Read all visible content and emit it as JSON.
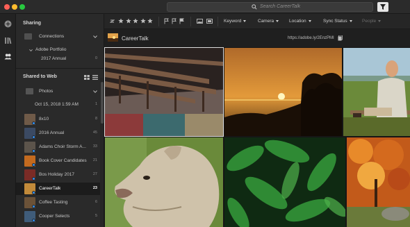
{
  "search": {
    "placeholder": "Search CareerTalk"
  },
  "sidebar": {
    "sharing": {
      "title": "Sharing",
      "connections_label": "Connections",
      "portfolio_label": "Adobe Portfolio",
      "portfolio_sub_label": "2017 Annual",
      "portfolio_sub_count": "0"
    },
    "shared_to_web": {
      "title": "Shared to Web",
      "photos_label": "Photos",
      "date_label": "Oct 15, 2018 1:59 AM",
      "date_count": "1"
    },
    "albums": [
      {
        "name": "8x10",
        "count": "8",
        "thumb": "#6f5a48",
        "selected": false
      },
      {
        "name": "2016 Annual",
        "count": "45",
        "thumb": "#3b4a63",
        "selected": false
      },
      {
        "name": "Adams Choir Storm A...",
        "count": "33",
        "thumb": "#5c544b",
        "selected": false
      },
      {
        "name": "Book Cover Candidates",
        "count": "21",
        "thumb": "#c36a1f",
        "selected": false
      },
      {
        "name": "Bos Holiday 2017",
        "count": "27",
        "thumb": "#7a2b26",
        "selected": false
      },
      {
        "name": "CareerTalk",
        "count": "23",
        "thumb": "#c28a3a",
        "selected": true
      },
      {
        "name": "Coffee Tasting",
        "count": "6",
        "thumb": "#6b5238",
        "selected": false
      },
      {
        "name": "Cooper Selects",
        "count": "5",
        "thumb": "#3f5c7a",
        "selected": false
      }
    ]
  },
  "toolbar": {
    "rating_count": "5",
    "dropdowns": [
      {
        "label": "Keyword",
        "disabled": false
      },
      {
        "label": "Camera",
        "disabled": false
      },
      {
        "label": "Location",
        "disabled": false
      },
      {
        "label": "Sync Status",
        "disabled": false
      },
      {
        "label": "People",
        "disabled": true
      }
    ]
  },
  "album_header": {
    "title": "CareerTalk",
    "share_url": "https://adobe.ly/2EnzPMI"
  },
  "colors": {
    "accent_blue": "#2f8ef1",
    "panel_bg": "#2a2a2a",
    "grid_bg": "#161616"
  }
}
